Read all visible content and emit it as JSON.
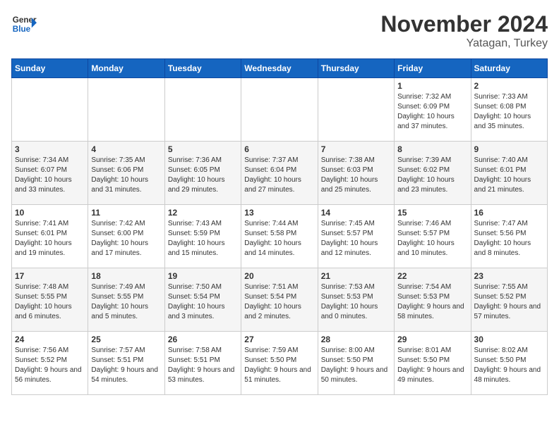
{
  "header": {
    "logo_general": "General",
    "logo_blue": "Blue",
    "month": "November 2024",
    "location": "Yatagan, Turkey"
  },
  "weekdays": [
    "Sunday",
    "Monday",
    "Tuesday",
    "Wednesday",
    "Thursday",
    "Friday",
    "Saturday"
  ],
  "weeks": [
    [
      {
        "day": "",
        "info": ""
      },
      {
        "day": "",
        "info": ""
      },
      {
        "day": "",
        "info": ""
      },
      {
        "day": "",
        "info": ""
      },
      {
        "day": "",
        "info": ""
      },
      {
        "day": "1",
        "info": "Sunrise: 7:32 AM\nSunset: 6:09 PM\nDaylight: 10 hours and 37 minutes."
      },
      {
        "day": "2",
        "info": "Sunrise: 7:33 AM\nSunset: 6:08 PM\nDaylight: 10 hours and 35 minutes."
      }
    ],
    [
      {
        "day": "3",
        "info": "Sunrise: 7:34 AM\nSunset: 6:07 PM\nDaylight: 10 hours and 33 minutes."
      },
      {
        "day": "4",
        "info": "Sunrise: 7:35 AM\nSunset: 6:06 PM\nDaylight: 10 hours and 31 minutes."
      },
      {
        "day": "5",
        "info": "Sunrise: 7:36 AM\nSunset: 6:05 PM\nDaylight: 10 hours and 29 minutes."
      },
      {
        "day": "6",
        "info": "Sunrise: 7:37 AM\nSunset: 6:04 PM\nDaylight: 10 hours and 27 minutes."
      },
      {
        "day": "7",
        "info": "Sunrise: 7:38 AM\nSunset: 6:03 PM\nDaylight: 10 hours and 25 minutes."
      },
      {
        "day": "8",
        "info": "Sunrise: 7:39 AM\nSunset: 6:02 PM\nDaylight: 10 hours and 23 minutes."
      },
      {
        "day": "9",
        "info": "Sunrise: 7:40 AM\nSunset: 6:01 PM\nDaylight: 10 hours and 21 minutes."
      }
    ],
    [
      {
        "day": "10",
        "info": "Sunrise: 7:41 AM\nSunset: 6:01 PM\nDaylight: 10 hours and 19 minutes."
      },
      {
        "day": "11",
        "info": "Sunrise: 7:42 AM\nSunset: 6:00 PM\nDaylight: 10 hours and 17 minutes."
      },
      {
        "day": "12",
        "info": "Sunrise: 7:43 AM\nSunset: 5:59 PM\nDaylight: 10 hours and 15 minutes."
      },
      {
        "day": "13",
        "info": "Sunrise: 7:44 AM\nSunset: 5:58 PM\nDaylight: 10 hours and 14 minutes."
      },
      {
        "day": "14",
        "info": "Sunrise: 7:45 AM\nSunset: 5:57 PM\nDaylight: 10 hours and 12 minutes."
      },
      {
        "day": "15",
        "info": "Sunrise: 7:46 AM\nSunset: 5:57 PM\nDaylight: 10 hours and 10 minutes."
      },
      {
        "day": "16",
        "info": "Sunrise: 7:47 AM\nSunset: 5:56 PM\nDaylight: 10 hours and 8 minutes."
      }
    ],
    [
      {
        "day": "17",
        "info": "Sunrise: 7:48 AM\nSunset: 5:55 PM\nDaylight: 10 hours and 6 minutes."
      },
      {
        "day": "18",
        "info": "Sunrise: 7:49 AM\nSunset: 5:55 PM\nDaylight: 10 hours and 5 minutes."
      },
      {
        "day": "19",
        "info": "Sunrise: 7:50 AM\nSunset: 5:54 PM\nDaylight: 10 hours and 3 minutes."
      },
      {
        "day": "20",
        "info": "Sunrise: 7:51 AM\nSunset: 5:54 PM\nDaylight: 10 hours and 2 minutes."
      },
      {
        "day": "21",
        "info": "Sunrise: 7:53 AM\nSunset: 5:53 PM\nDaylight: 10 hours and 0 minutes."
      },
      {
        "day": "22",
        "info": "Sunrise: 7:54 AM\nSunset: 5:53 PM\nDaylight: 9 hours and 58 minutes."
      },
      {
        "day": "23",
        "info": "Sunrise: 7:55 AM\nSunset: 5:52 PM\nDaylight: 9 hours and 57 minutes."
      }
    ],
    [
      {
        "day": "24",
        "info": "Sunrise: 7:56 AM\nSunset: 5:52 PM\nDaylight: 9 hours and 56 minutes."
      },
      {
        "day": "25",
        "info": "Sunrise: 7:57 AM\nSunset: 5:51 PM\nDaylight: 9 hours and 54 minutes."
      },
      {
        "day": "26",
        "info": "Sunrise: 7:58 AM\nSunset: 5:51 PM\nDaylight: 9 hours and 53 minutes."
      },
      {
        "day": "27",
        "info": "Sunrise: 7:59 AM\nSunset: 5:50 PM\nDaylight: 9 hours and 51 minutes."
      },
      {
        "day": "28",
        "info": "Sunrise: 8:00 AM\nSunset: 5:50 PM\nDaylight: 9 hours and 50 minutes."
      },
      {
        "day": "29",
        "info": "Sunrise: 8:01 AM\nSunset: 5:50 PM\nDaylight: 9 hours and 49 minutes."
      },
      {
        "day": "30",
        "info": "Sunrise: 8:02 AM\nSunset: 5:50 PM\nDaylight: 9 hours and 48 minutes."
      }
    ]
  ]
}
